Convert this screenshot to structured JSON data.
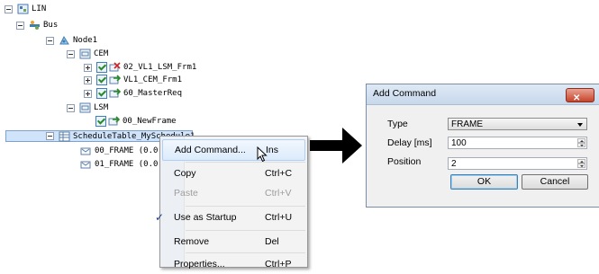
{
  "tree": {
    "items": [
      {
        "label": "LIN"
      },
      {
        "label": "Bus"
      },
      {
        "label": "Node1"
      },
      {
        "label": "CEM"
      },
      {
        "label": "02_VL1_LSM_Frm1"
      },
      {
        "label": "VL1_CEM_Frm1"
      },
      {
        "label": "60_MasterReq"
      },
      {
        "label": "LSM"
      },
      {
        "label": "00_NewFrame"
      },
      {
        "label": "ScheduleTable_MySchedule1"
      },
      {
        "label": "00_FRAME (0.0"
      },
      {
        "label": "01_FRAME (0.0"
      }
    ]
  },
  "context_menu": {
    "items": [
      {
        "label": "Add Command...",
        "shortcut": "Ins"
      },
      {
        "label": "Copy",
        "shortcut": "Ctrl+C"
      },
      {
        "label": "Paste",
        "shortcut": "Ctrl+V"
      },
      {
        "label": "Use as Startup",
        "shortcut": "Ctrl+U",
        "check": "✓"
      },
      {
        "label": "Remove",
        "shortcut": "Del"
      },
      {
        "label": "Properties...",
        "shortcut": "Ctrl+P"
      }
    ]
  },
  "dialog": {
    "title": "Add Command",
    "close_glyph": "✕",
    "type_label": "Type",
    "type_value": "FRAME",
    "delay_label": "Delay [ms]",
    "delay_value": "100",
    "position_label": "Position",
    "position_value": "2",
    "ok_label": "OK",
    "cancel_label": "Cancel"
  },
  "colors": {
    "selection": "#cfe3fb",
    "dialog_bg": "#f0f0f0",
    "close_button": "#c7432a"
  }
}
